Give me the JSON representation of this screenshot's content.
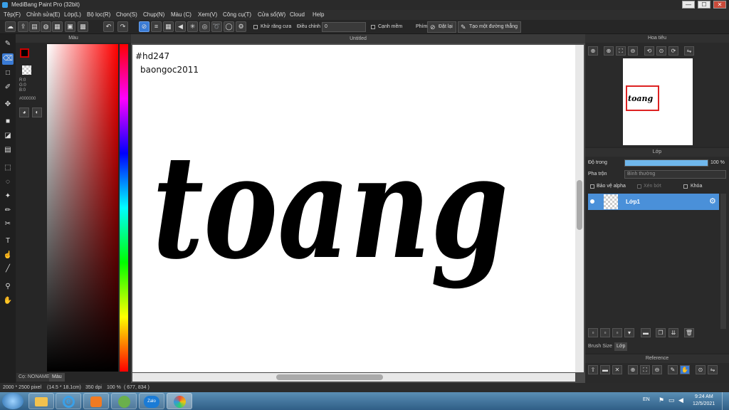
{
  "window": {
    "title": "MediBang Paint Pro (32bit)",
    "minimize": "—",
    "maximize": "☐",
    "close": "✕"
  },
  "menu": [
    "Tệp(F)",
    "Chỉnh sửa(E)",
    "Lớp(L)",
    "Bộ lọc(R)",
    "Chọn(S)",
    "Chụp(N)",
    "Màu (C)",
    "Xem(V)",
    "Công cụ(T)",
    "Cửa sổ(W)",
    "Cloud",
    "Help"
  ],
  "toolbar": {
    "antialias_label": "Khử răng cưa",
    "correction_label": "Điều chỉnh",
    "correction_value": "0",
    "edge_label": "Cạnh mềm",
    "key_label": "Phím",
    "reset_label": "Đặt lại",
    "straight_line_label": "Tạo một đường thẳng"
  },
  "color_panel": {
    "title": "Màu",
    "rgb_r": "R:0",
    "rgb_g": "G:0",
    "rgb_b": "B:0",
    "hex": "#000000",
    "tab_brush": "Cọ: NONAME",
    "tab_color": "Màu",
    "primary_color": "#000000"
  },
  "document": {
    "tab_title": "Untitled",
    "handwriting_line1": "#hd247",
    "handwriting_line2": "baongoc2011",
    "artwork_text": "toang"
  },
  "navigator": {
    "title": "Hoa tiêu",
    "thumbnail_text": "toang"
  },
  "layer_panel": {
    "title": "Lớp",
    "opacity_label": "Độ trong",
    "opacity_value": "100 %",
    "opacity_fraction": 1.0,
    "blend_label": "Pha trộn",
    "blend_value": "Bình thường",
    "protect_alpha": "Bảo vệ alpha",
    "clip": "Xén bớt",
    "lock": "Khóa",
    "layers": [
      {
        "name": "Lớp1"
      }
    ],
    "tab_brush_size": "Brush Size",
    "tab_layer": "Lớp"
  },
  "reference": {
    "title": "Reference"
  },
  "status": {
    "size": "2000 * 2500 pixel",
    "dims": "(14.5 * 18.1cm)",
    "dpi": "350 dpi",
    "zoom": "100 %",
    "coords": "( 677, 834 )"
  },
  "taskbar": {
    "lang": "EN",
    "time": "9:24 AM",
    "date": "12/5/2021",
    "zalo": "Zalo"
  }
}
